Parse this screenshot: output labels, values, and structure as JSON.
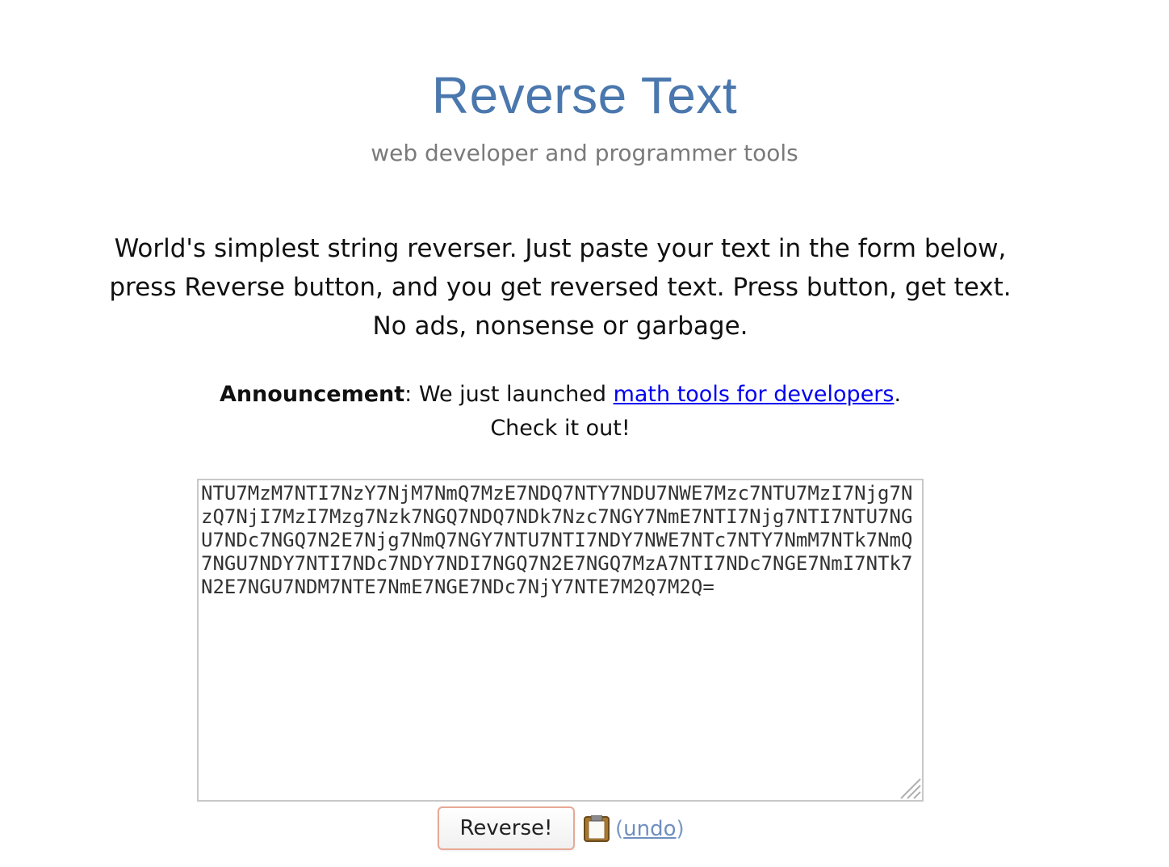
{
  "header": {
    "title": "Reverse Text",
    "subtitle": "web developer and programmer tools"
  },
  "intro": {
    "text": "World's simplest string reverser. Just paste your text in the form below, press Reverse button, and you get reversed text. Press button, get text. No ads, nonsense or garbage."
  },
  "announcement": {
    "label": "Announcement",
    "before_link": ": We just launched ",
    "link_text": "math tools for developers",
    "after_link": ". Check it out!"
  },
  "editor": {
    "value": "NTU7MzM7NTI7NzY7NjM7NmQ7MzE7NDQ7NTY7NDU7NWE7Mzc7NTU7MzI7Njg7NzQ7NjI7MzI7Mzg7Nzk7NGQ7NDQ7NDk7Nzc7NGY7NmE7NTI7Njg7NTI7NTU7NGU7NDc7NGQ7N2E7Njg7NmQ7NGY7NTU7NTI7NDY7NWE7NTc7NTY7NmM7NTk7NmQ7NGU7NDY7NTI7NDc7NDY7NDI7NGQ7N2E7NGQ7MzA7NTI7NDc7NGE7NmI7NTk7N2E7NGU7NDM7NTE7NmE7NGE7NDc7NjY7NTE7M2Q7M2Q="
  },
  "controls": {
    "reverse_label": "Reverse!",
    "undo_open": "(",
    "undo_label": "undo",
    "undo_close": ")"
  },
  "icons": {
    "clipboard": "clipboard-icon",
    "resize": "resize-grip-icon"
  },
  "colors": {
    "title": "#4a77ad",
    "subtitle": "#7a7a7a",
    "link": "#0000ee",
    "undo_link": "#6f8fbf",
    "button_border": "#e8a894"
  }
}
